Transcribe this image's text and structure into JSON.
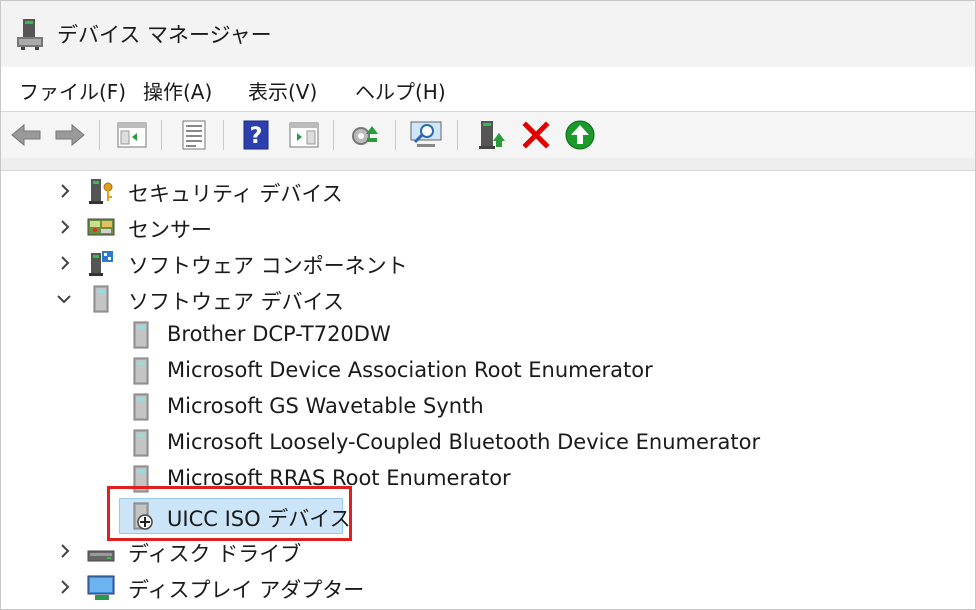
{
  "window": {
    "title": "デバイス マネージャー"
  },
  "menubar": {
    "items": [
      {
        "label": "ファイル(F)"
      },
      {
        "label": "操作(A)"
      },
      {
        "label": "表示(V)"
      },
      {
        "label": "ヘルプ(H)"
      }
    ]
  },
  "toolbar": {
    "icons": [
      "back-arrow-icon",
      "forward-arrow-icon",
      "show-hide-console-tree-icon",
      "properties-icon",
      "help-icon",
      "action-pane-icon",
      "update-driver-icon",
      "scan-hardware-icon",
      "enable-device-icon",
      "uninstall-device-icon",
      "update-driver-green-icon"
    ]
  },
  "tree": {
    "items": [
      {
        "label": "セキュリティ デバイス",
        "level": 0,
        "expanded": false,
        "icon": "security-device-icon"
      },
      {
        "label": "センサー",
        "level": 0,
        "expanded": false,
        "icon": "sensor-icon"
      },
      {
        "label": "ソフトウェア コンポーネント",
        "level": 0,
        "expanded": false,
        "icon": "software-component-icon"
      },
      {
        "label": "ソフトウェア デバイス",
        "level": 0,
        "expanded": true,
        "icon": "software-device-icon"
      },
      {
        "label": "Brother DCP-T720DW",
        "level": 1,
        "icon": "device-tower-icon"
      },
      {
        "label": "Microsoft Device Association Root Enumerator",
        "level": 1,
        "icon": "device-tower-icon"
      },
      {
        "label": "Microsoft GS Wavetable Synth",
        "level": 1,
        "icon": "device-tower-icon"
      },
      {
        "label": "Microsoft Loosely-Coupled Bluetooth Device Enumerator",
        "level": 1,
        "icon": "device-tower-icon"
      },
      {
        "label": "Microsoft RRAS Root Enumerator",
        "level": 1,
        "icon": "device-tower-icon"
      },
      {
        "label": "UICC ISO デバイス",
        "level": 1,
        "selected": true,
        "icon": "device-tower-warning-icon"
      },
      {
        "label": "ディスク ドライブ",
        "level": 0,
        "expanded": false,
        "icon": "disk-drive-icon"
      },
      {
        "label": "ディスプレイ アダプター",
        "level": 0,
        "expanded": false,
        "icon": "display-adapter-icon"
      }
    ]
  },
  "colors": {
    "selection": "#cce4f7",
    "highlight_border": "#e02020",
    "delete_red": "#e00000",
    "green": "#1a9a2a"
  }
}
